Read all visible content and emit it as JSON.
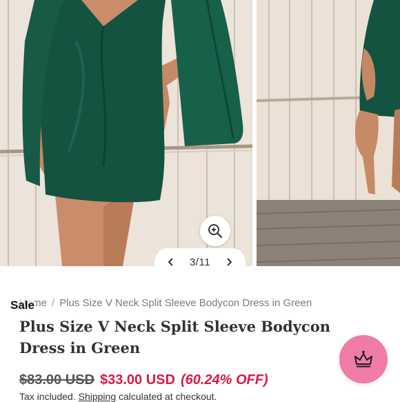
{
  "gallery": {
    "counter": "3/11"
  },
  "breadcrumb": {
    "home": "Home",
    "separator": "/",
    "current": "Plus Size V Neck Split Sleeve Bodycon Dress in Green"
  },
  "badge": {
    "sale": "Sale"
  },
  "product": {
    "title": "Plus Size V Neck Split Sleeve Bodycon Dress in Green",
    "price_compare": "$83.00 USD",
    "price_sale": "$33.00 USD",
    "discount": "(60.24% OFF)",
    "tax_text": "Tax included.",
    "shipping_link": "Shipping",
    "shipping_tail": "calculated at checkout."
  },
  "icons": {
    "zoom": "zoom-in-icon",
    "prev": "chevron-left-icon",
    "next": "chevron-right-icon",
    "rewards": "crown-icon"
  },
  "colors": {
    "dress": "#14533f",
    "sale_price": "#d8194b",
    "rewards_bg": "#f07ba6"
  }
}
